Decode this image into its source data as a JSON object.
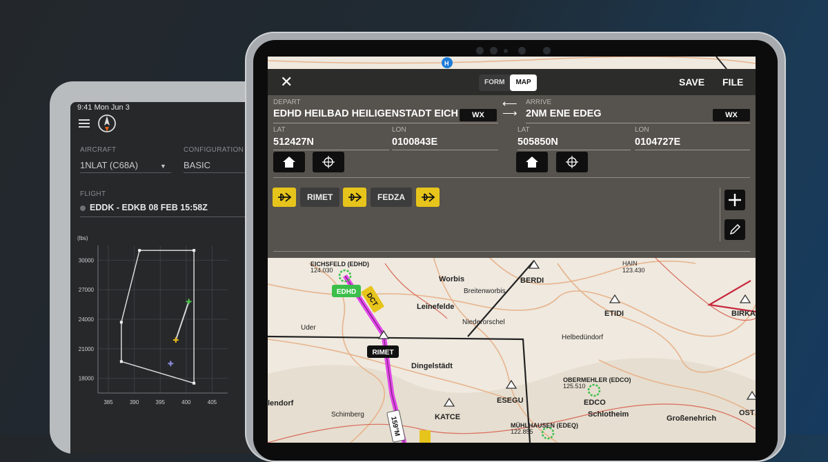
{
  "left_tablet": {
    "status_time": "9:41 Mon Jun 3",
    "aircraft_label": "AIRCRAFT",
    "aircraft_value": "1NLAT (C68A)",
    "configuration_label": "CONFIGURATION",
    "configuration_value": "BASIC",
    "flight_label": "FLIGHT",
    "flight_value": "EDDK - EDKB  08 FEB 15:58Z",
    "chart": {
      "ylabel": "(lbs)",
      "y_ticks": [
        "30000",
        "27000",
        "24000",
        "21000",
        "18000"
      ],
      "x_ticks": [
        "385",
        "390",
        "395",
        "400",
        "405"
      ]
    }
  },
  "chart_data": {
    "type": "scatter",
    "ylabel": "(lbs)",
    "xlim": [
      383,
      408
    ],
    "ylim": [
      16500,
      31500
    ],
    "grid": true,
    "series": [
      {
        "values": [
          {
            "x": 387.5,
            "y": 23700
          },
          {
            "x": 387.5,
            "y": 19700
          },
          {
            "x": 401.5,
            "y": 17500
          },
          {
            "x": 401.5,
            "y": 31000
          },
          {
            "x": 391,
            "y": 31000
          }
        ]
      },
      {
        "values": [
          {
            "x": 400.5,
            "y": 25800
          },
          {
            "x": 398,
            "y": 21900
          }
        ]
      }
    ],
    "points": [
      {
        "x": 400.5,
        "y": 25800,
        "color": "#4fc24c"
      },
      {
        "x": 398,
        "y": 21900,
        "color": "#e2b51e"
      },
      {
        "x": 397,
        "y": 19500,
        "color": "#8a86d8"
      }
    ]
  },
  "right_tablet": {
    "topbar": {
      "close_icon": "close-icon",
      "form_tab": "FORM",
      "map_tab": "MAP",
      "save": "SAVE",
      "file": "FILE"
    },
    "depart": {
      "label": "DEPART",
      "value": "EDHD HEILBAD HEILIGENSTADT EICH _",
      "wx": "WX",
      "lat_label": "LAT",
      "lat_value": "512427N",
      "lon_label": "LON",
      "lon_value": "0100843E"
    },
    "arrive": {
      "label": "ARRIVE",
      "value": "2NM ENE EDEG",
      "wx": "WX",
      "lat_label": "LAT",
      "lat_value": "505850N",
      "lon_label": "LON",
      "lon_value": "0104727E"
    },
    "route": [
      "RIMET",
      "FEDZA"
    ],
    "map_labels": [
      {
        "text": "EICHSFELD (EDHD)"
      },
      {
        "text": "124.030"
      },
      {
        "text": "Worbis"
      },
      {
        "text": "Breitenworbis"
      },
      {
        "text": "BERDI"
      },
      {
        "text": "HAIN"
      },
      {
        "text": "123.430"
      },
      {
        "text": "Leinefelde"
      },
      {
        "text": "ETIDI"
      },
      {
        "text": "BIRKA"
      },
      {
        "text": "Uder"
      },
      {
        "text": "Niederorschel"
      },
      {
        "text": "Helbedündorf"
      },
      {
        "text": "Dingelstädt"
      },
      {
        "text": "OBERMEHLER (EDCO)"
      },
      {
        "text": "125.510"
      },
      {
        "text": "ESEGU"
      },
      {
        "text": "EDCO"
      },
      {
        "text": "Schlotheim"
      },
      {
        "text": "Großenehrich"
      },
      {
        "text": "lendorf"
      },
      {
        "text": "Schimberg"
      },
      {
        "text": "KATCE"
      },
      {
        "text": "MÜHLHAUSEN (EDEQ)"
      },
      {
        "text": "122.855"
      },
      {
        "text": "OST"
      }
    ],
    "map_tags": {
      "edhd": "EDHD",
      "dct": "DCT",
      "rimet": "RIMET",
      "course": "159°M"
    },
    "colors": {
      "route": "#e040e8",
      "chip": "#e7c41b",
      "panel": "#4a4642"
    }
  }
}
